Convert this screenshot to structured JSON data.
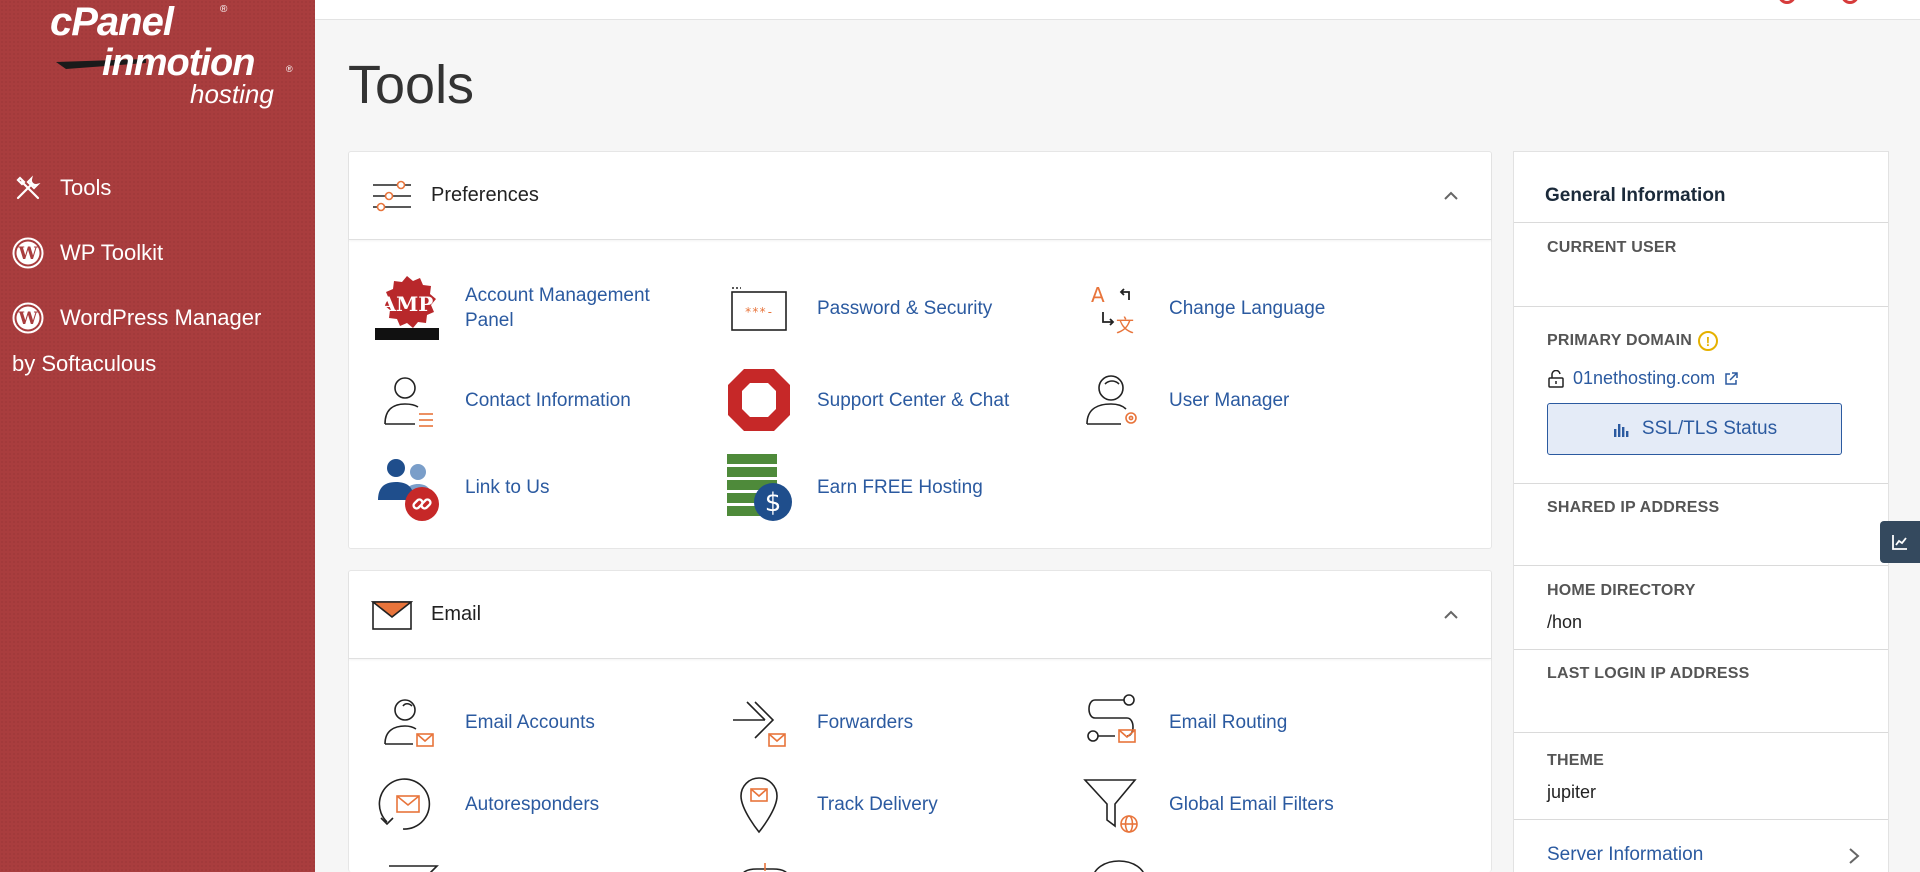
{
  "brand": {
    "primary": "cPanel",
    "secondary": "inmotion",
    "tertiary": "hosting",
    "registered": "®"
  },
  "sidebar": {
    "items": [
      {
        "label": "Tools",
        "icon": "tools-icon"
      },
      {
        "label": "WP Toolkit",
        "icon": "wordpress-icon"
      },
      {
        "label": "WordPress Manager",
        "icon": "wordpress-icon",
        "sublabel": "by Softaculous"
      }
    ],
    "background": "#a93d3e"
  },
  "page": {
    "title": "Tools"
  },
  "preferences": {
    "title": "Preferences",
    "tools": [
      {
        "label": "Account Management Panel",
        "icon": "amp-badge-icon"
      },
      {
        "label": "Password & Security",
        "icon": "password-icon"
      },
      {
        "label": "Change Language",
        "icon": "language-icon"
      },
      {
        "label": "Contact Information",
        "icon": "contact-info-icon"
      },
      {
        "label": "Support Center & Chat",
        "icon": "support-lifebuoy-icon"
      },
      {
        "label": "User Manager",
        "icon": "user-manager-icon"
      },
      {
        "label": "Link to Us",
        "icon": "link-to-us-icon"
      },
      {
        "label": "Earn FREE Hosting",
        "icon": "earn-hosting-icon"
      }
    ],
    "amp_badge_text": "AMP",
    "password_mask": "***-",
    "language_glyph_a": "A",
    "language_glyph_b": "文"
  },
  "email": {
    "title": "Email",
    "tools": [
      {
        "label": "Email Accounts",
        "icon": "email-accounts-icon"
      },
      {
        "label": "Forwarders",
        "icon": "forwarders-icon"
      },
      {
        "label": "Email Routing",
        "icon": "email-routing-icon"
      },
      {
        "label": "Autoresponders",
        "icon": "autoresponders-icon"
      },
      {
        "label": "Track Delivery",
        "icon": "track-delivery-icon"
      },
      {
        "label": "Global Email Filters",
        "icon": "global-filters-icon"
      }
    ]
  },
  "info": {
    "title": "General Information",
    "current_user_label": "CURRENT USER",
    "primary_domain_label": "PRIMARY DOMAIN",
    "primary_domain_warn": "!",
    "domain": "01nethosting.com",
    "ssl_button": "SSL/TLS Status",
    "shared_ip_label": "SHARED IP ADDRESS",
    "home_dir_label": "HOME DIRECTORY",
    "home_dir_value": "/hon",
    "last_login_label": "LAST LOGIN IP ADDRESS",
    "theme_label": "THEME",
    "theme_value": "jupiter",
    "server_info": "Server Information"
  },
  "colors": {
    "link": "#2b5aa0",
    "accent_orange": "#e8743b",
    "warning": "#e5b100"
  }
}
